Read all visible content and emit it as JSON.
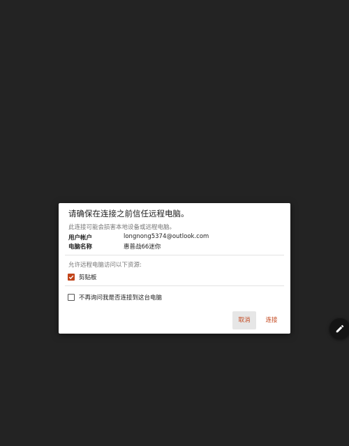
{
  "dialog": {
    "title": "请确保在连接之前信任远程电脑。",
    "subtitle": "此连接可能会损害本地设备或远程电脑。",
    "info": [
      {
        "label": "用户帐户",
        "value": "longnong5374@outlook.com"
      },
      {
        "label": "电脑名称",
        "value": "惠普战66迷你"
      }
    ],
    "resources_label": "允许远程电脑访问以下资源:",
    "clipboard": {
      "label": "剪贴板",
      "checked": true
    },
    "dont_ask": {
      "label": "不再询问我是否连接到这台电脑",
      "checked": false
    },
    "buttons": {
      "cancel": "取消",
      "connect": "连接"
    }
  },
  "fab": {
    "icon": "pencil-icon"
  },
  "colors": {
    "background": "#232323",
    "dialog": "#ffffff",
    "accent": "#c2441a",
    "cancel_button_bg": "#e6e6e6"
  }
}
